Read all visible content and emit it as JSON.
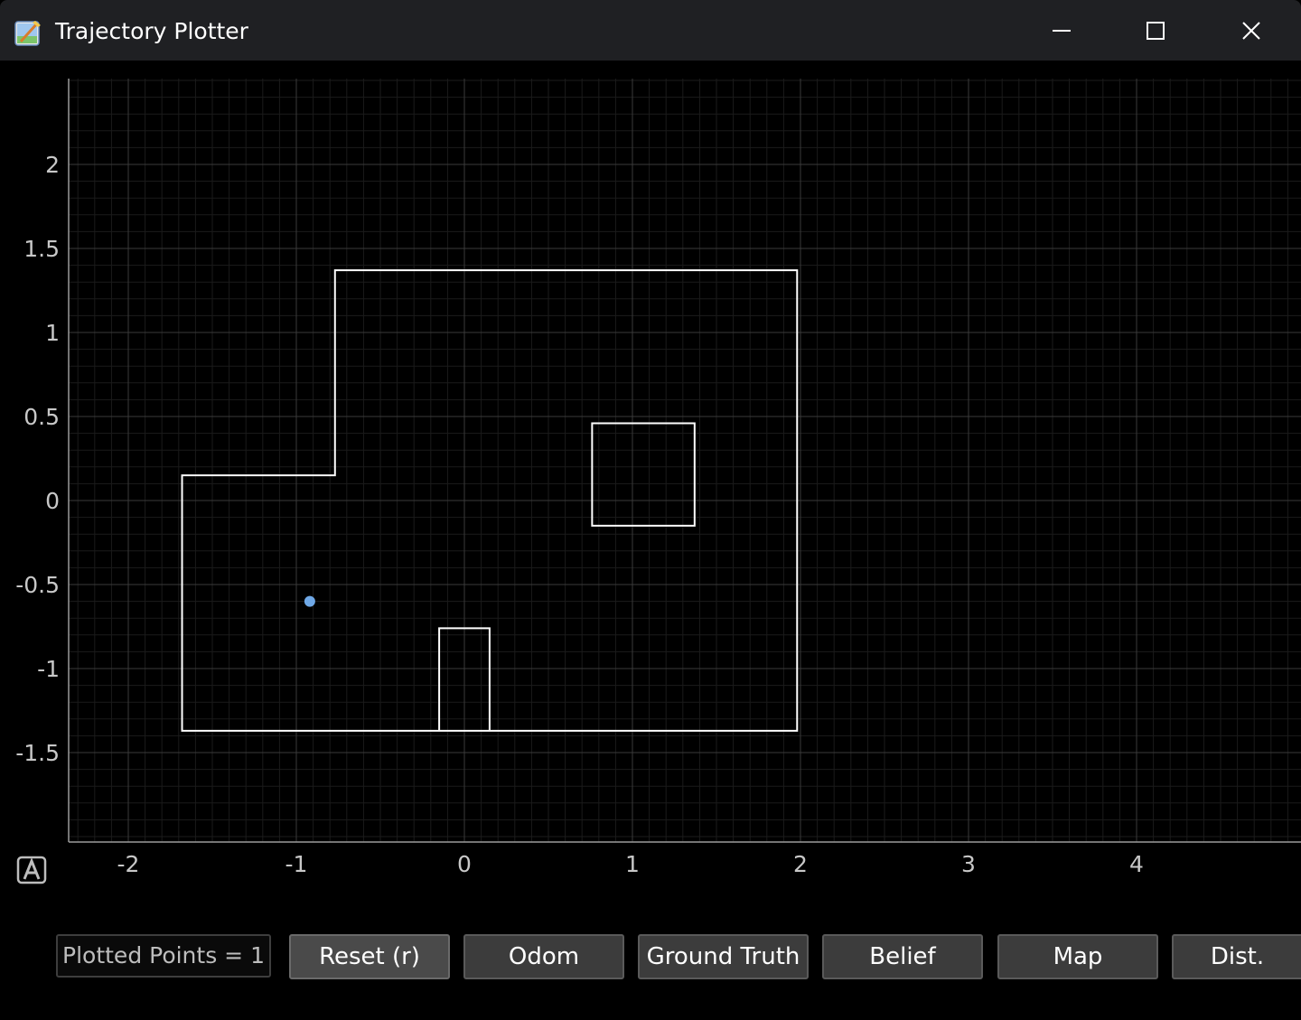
{
  "window": {
    "title": "Trajectory Plotter",
    "controls": {
      "minimize": "minimize-icon",
      "maximize": "maximize-icon",
      "close": "close-icon"
    }
  },
  "plot": {
    "background": "#000000",
    "grid_color": "#3a3a3a",
    "x_ticks": [
      "-2",
      "-1",
      "0",
      "1",
      "2",
      "3",
      "4"
    ],
    "y_ticks": [
      "2",
      "1.5",
      "1",
      "0.5",
      "0",
      "-0.5",
      "-1",
      "-1.5"
    ],
    "xlim": [
      -2.35,
      4.95
    ],
    "ylim": [
      -2.0,
      2.5
    ],
    "map_color": "#ffffff",
    "map": {
      "outer_boundary": [
        [
          -1.68,
          0.15
        ],
        [
          -0.77,
          0.15
        ],
        [
          -0.77,
          1.37
        ],
        [
          1.98,
          1.37
        ],
        [
          1.98,
          -1.37
        ],
        [
          -1.68,
          -1.37
        ]
      ],
      "obstacle_box": [
        [
          0.76,
          0.46
        ],
        [
          1.37,
          0.46
        ],
        [
          1.37,
          -0.15
        ],
        [
          0.76,
          -0.15
        ]
      ],
      "wall_stub": [
        [
          -0.15,
          -1.37
        ],
        [
          -0.15,
          -0.76
        ],
        [
          0.15,
          -0.76
        ],
        [
          0.15,
          -1.37
        ]
      ]
    },
    "points": [
      {
        "x": -0.92,
        "y": -0.6,
        "color": "#6fa8e6"
      }
    ],
    "auto_range_icon": "auto-range-icon"
  },
  "controls": {
    "counter": "Plotted Points = 1",
    "reset": "Reset (r)",
    "odom": "Odom",
    "ground_truth": "Ground Truth",
    "belief": "Belief",
    "map": "Map",
    "dist": "Dist."
  }
}
